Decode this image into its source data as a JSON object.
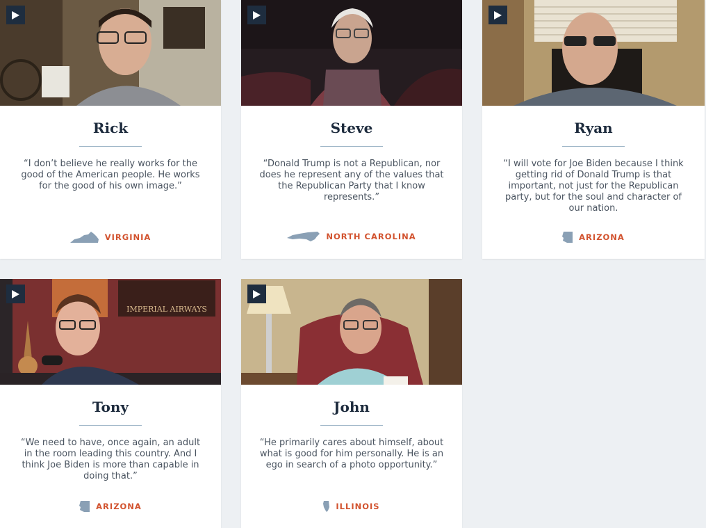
{
  "cards": [
    {
      "name": "Rick",
      "quote": "“I don’t believe he really works for the good of the American people. He works for the good of his own image.”",
      "state": "VIRGINIA",
      "state_icon": "virginia-state-icon"
    },
    {
      "name": "Steve",
      "quote": "“Donald Trump is not a Republican, nor does he represent any of the values that the Republican Party that I know represents.”",
      "state": "NORTH CAROLINA",
      "state_icon": "north-carolina-state-icon"
    },
    {
      "name": "Ryan",
      "quote": "“I will vote for Joe Biden because I think getting rid of Donald Trump is that important, not just for the Republican party, but for the soul and character of our nation.",
      "state": "ARIZONA",
      "state_icon": "arizona-state-icon"
    },
    {
      "name": "Tony",
      "quote": "“We need to have, once again, an adult in the room leading this country. And I think Joe Biden is more than capable in doing that.”",
      "state": "ARIZONA",
      "state_icon": "arizona-state-icon"
    },
    {
      "name": "John",
      "quote": "“He primarily cares about himself, about what is good for him personally. He is an ego in search of a photo opportunity.”",
      "state": "ILLINOIS",
      "state_icon": "illinois-state-icon"
    }
  ],
  "colors": {
    "page_bg": "#edf0f3",
    "name_text": "#1d2b3d",
    "state_label": "#d2532f",
    "state_shape": "#8aa0b5",
    "play_button_bg": "#1e2d3f"
  }
}
